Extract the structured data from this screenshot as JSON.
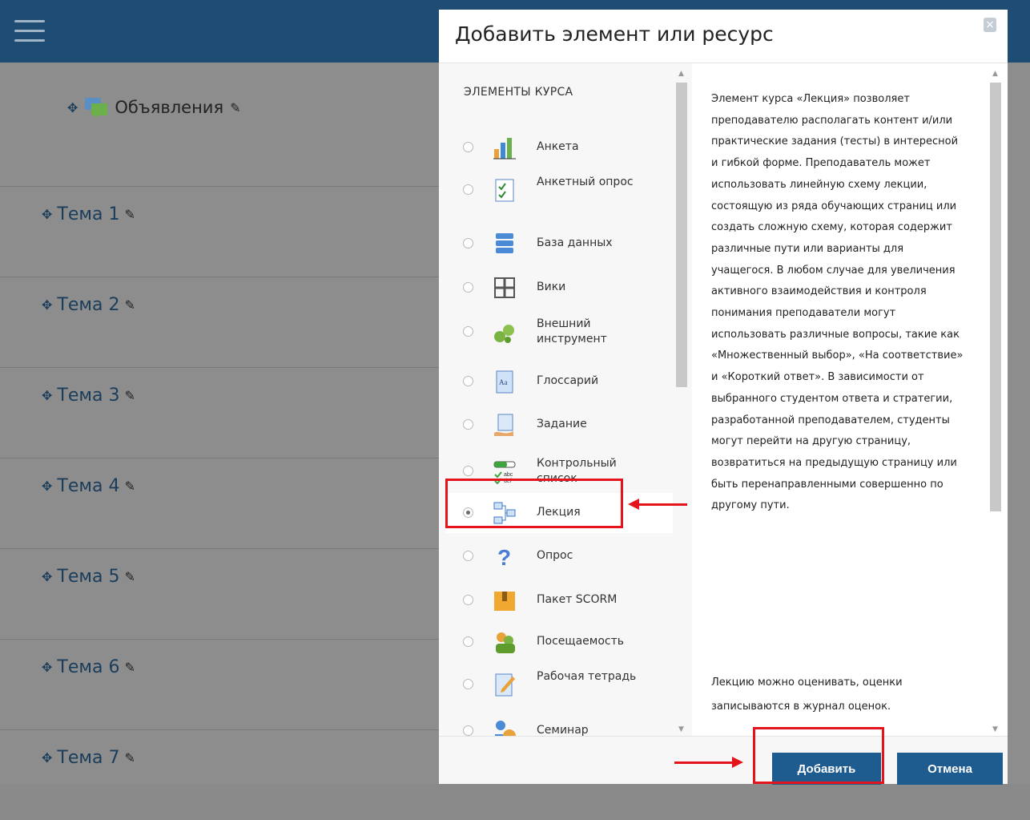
{
  "page": {
    "announcements": "Объявления",
    "topics": [
      "Тема 1",
      "Тема 2",
      "Тема 3",
      "Тема 4",
      "Тема 5",
      "Тема 6",
      "Тема 7"
    ]
  },
  "modal": {
    "title": "Добавить элемент или ресурс",
    "section_header": "ЭЛЕМЕНТЫ КУРСА",
    "options": [
      {
        "label": "Анкета",
        "icon": "feedback-chart-icon"
      },
      {
        "label": "Анкетный опрос",
        "icon": "survey-icon"
      },
      {
        "label": "База данных",
        "icon": "database-icon"
      },
      {
        "label": "Вики",
        "icon": "wiki-icon"
      },
      {
        "label": "Внешний инструмент",
        "icon": "puzzle-icon"
      },
      {
        "label": "Глоссарий",
        "icon": "glossary-icon"
      },
      {
        "label": "Задание",
        "icon": "assignment-icon"
      },
      {
        "label": "Контрольный список",
        "icon": "checklist-icon"
      },
      {
        "label": "Лекция",
        "icon": "lesson-icon",
        "selected": true
      },
      {
        "label": "Опрос",
        "icon": "question-icon"
      },
      {
        "label": "Пакет SCORM",
        "icon": "scorm-package-icon"
      },
      {
        "label": "Посещаемость",
        "icon": "attendance-icon"
      },
      {
        "label": "Рабочая тетрадь",
        "icon": "journal-icon"
      },
      {
        "label": "Семинар",
        "icon": "workshop-icon"
      }
    ],
    "description": "Элемент курса «Лекция» позволяет преподавателю располагать контент и/или практические задания (тесты) в интересной и гибкой форме. Преподаватель может использовать линейную схему лекции, состоящую из ряда обучающих страниц или создать сложную схему, которая содержит различные пути или варианты для учащегося. В любом случае для увеличения активного взаимодействия и контроля понимания преподаватели могут использовать различные вопросы, такие как «Множественный выбор», «На соответствие» и «Короткий ответ». В зависимости от выбранного студентом ответа и стратегии, разработанной преподавателем, студенты могут перейти на другую страницу, возвратиться на предыдущую страницу или быть перенаправленными совершенно по другому пути.",
    "description_note": "Лекцию можно оценивать, оценки записываются в журнал оценок.",
    "add_button": "Добавить",
    "cancel_button": "Отмена"
  },
  "colors": {
    "header_bg": "#1e4c73",
    "button_bg": "#1e5b8f",
    "annotation_red": "#e3141b"
  }
}
